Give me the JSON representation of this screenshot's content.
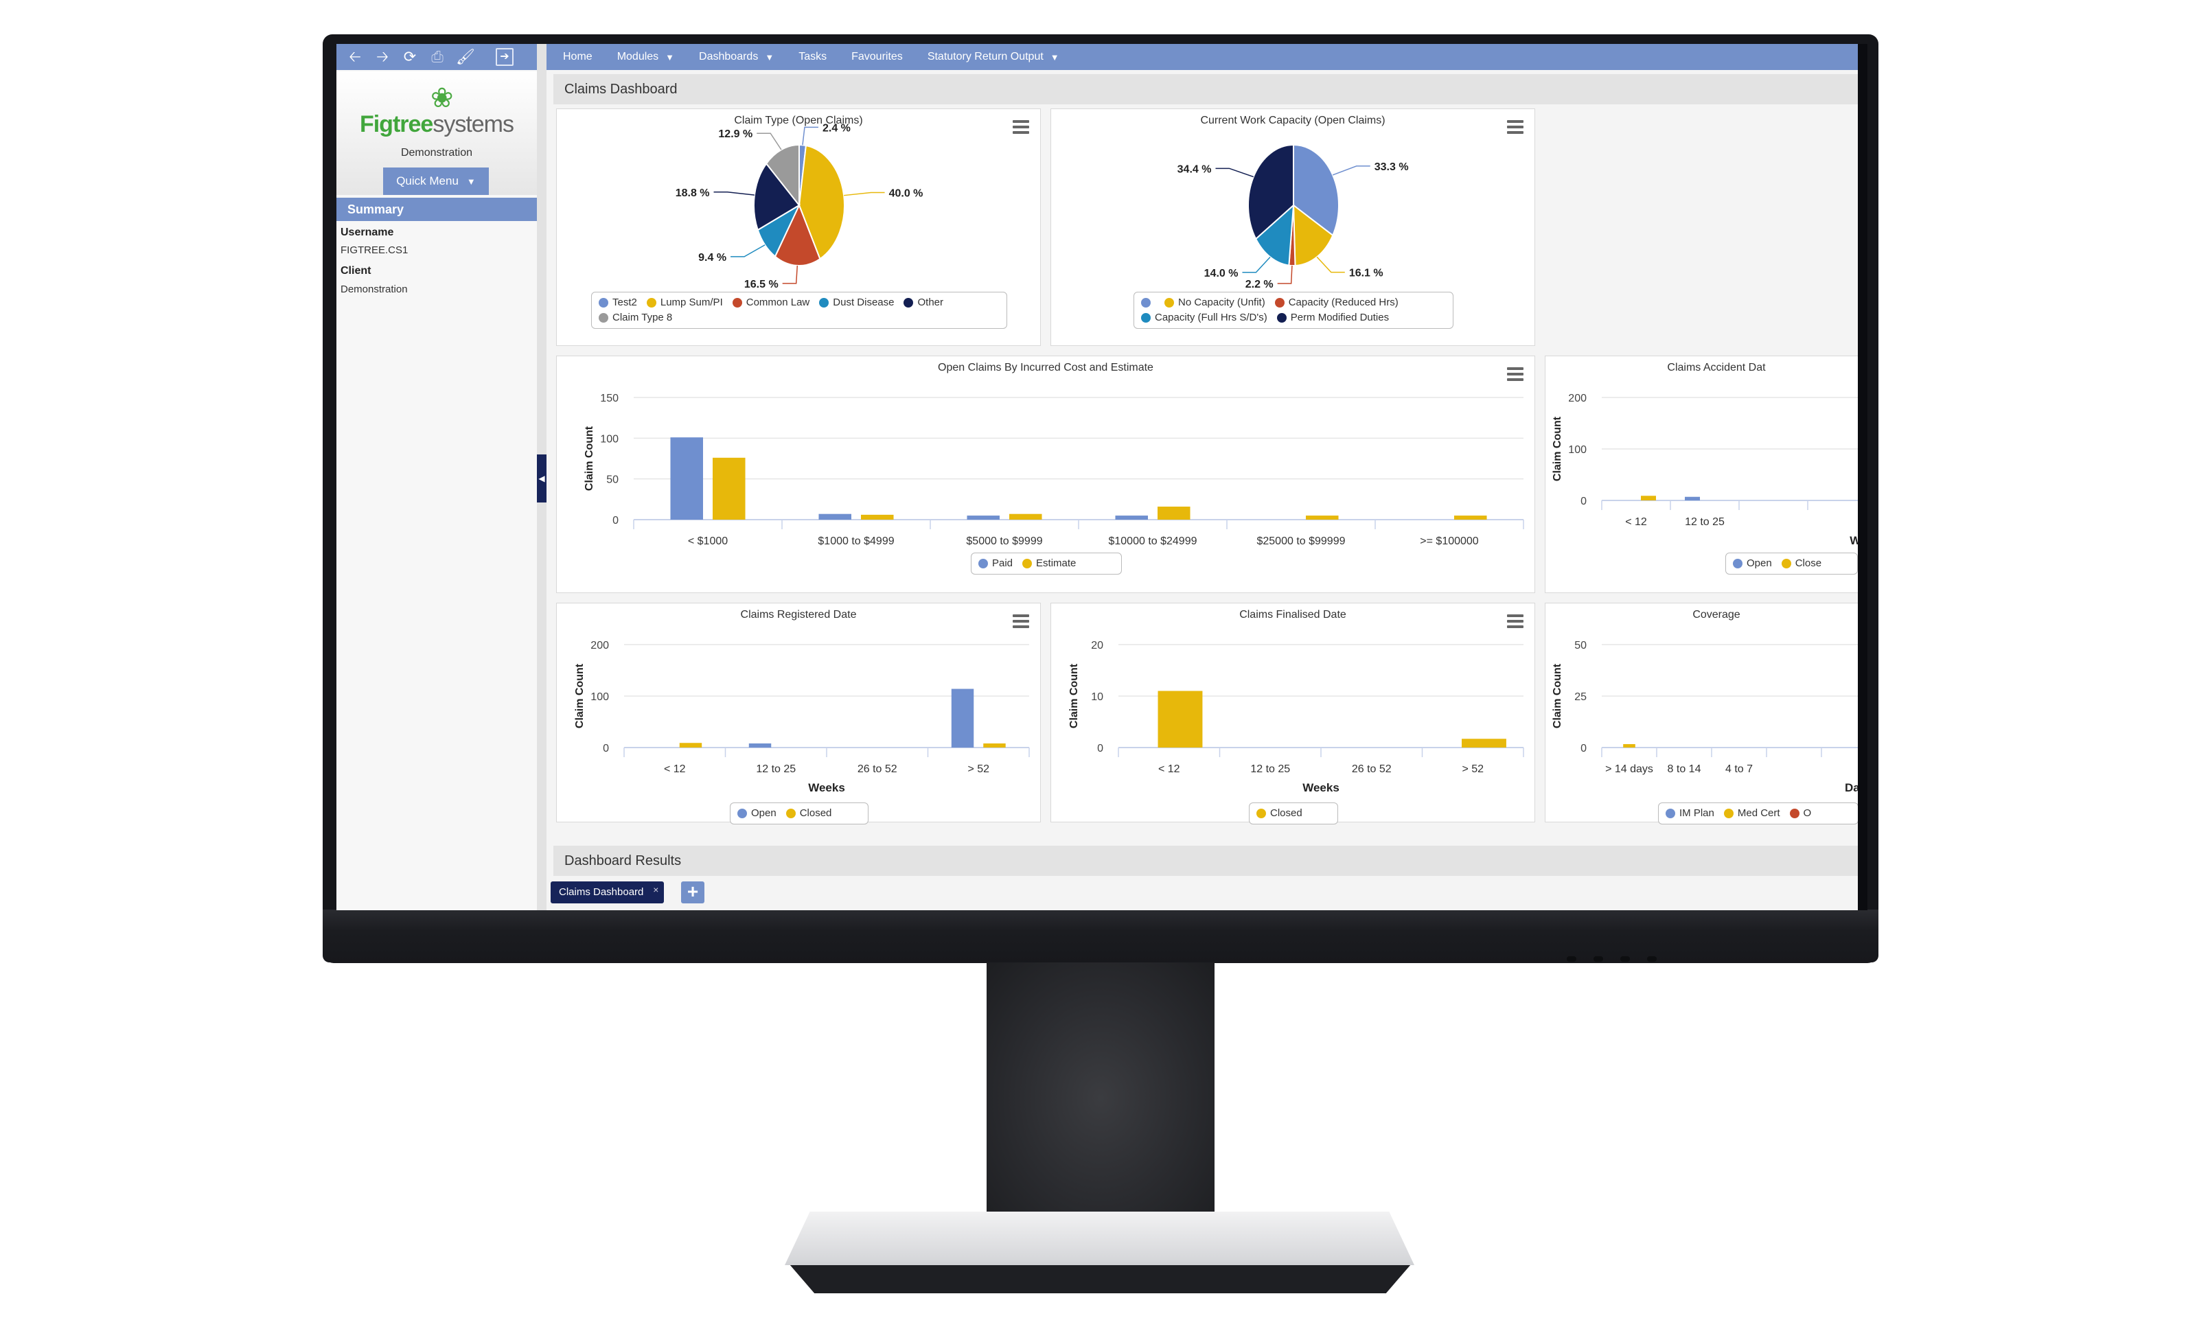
{
  "toolbar": {
    "icons": [
      "back-arrow-icon",
      "forward-arrow-icon",
      "refresh-icon",
      "print-icon",
      "brush-icon",
      "logout-icon"
    ]
  },
  "brand": {
    "name_green": "Figtree",
    "name_grey": "systems",
    "client": "Demonstration"
  },
  "quick_menu": {
    "label": "Quick Menu"
  },
  "summary": {
    "title": "Summary",
    "username_label": "Username",
    "username": "FIGTREE.CS1",
    "client_label": "Client",
    "client": "Demonstration"
  },
  "nav": {
    "items": [
      {
        "label": "Home",
        "dropdown": false
      },
      {
        "label": "Modules",
        "dropdown": true
      },
      {
        "label": "Dashboards",
        "dropdown": true
      },
      {
        "label": "Tasks",
        "dropdown": false
      },
      {
        "label": "Favourites",
        "dropdown": false
      },
      {
        "label": "Statutory Return Output",
        "dropdown": true
      }
    ]
  },
  "dashboard": {
    "title": "Claims Dashboard"
  },
  "results": {
    "title": "Dashboard Results",
    "tab_label": "Claims Dashboard",
    "close": "×",
    "add": "+"
  },
  "colors": {
    "blue": "#6f8fcf",
    "yellow": "#e7b80b",
    "red": "#c4492b",
    "teal": "#1f8bbf",
    "navy": "#131f52",
    "grey": "#9a9a9a",
    "accent": "#7390c9"
  },
  "chart_data": [
    {
      "id": "claim-type",
      "type": "pie",
      "title": "Claim Type (Open Claims)",
      "slices": [
        {
          "label": "Test2",
          "value": 2.4,
          "color": "#6f8fcf"
        },
        {
          "label": "Lump Sum/PI",
          "value": 40.0,
          "color": "#e7b80b"
        },
        {
          "label": "Common Law",
          "value": 16.5,
          "color": "#c4492b"
        },
        {
          "label": "Dust Disease",
          "value": 9.4,
          "color": "#1f8bbf"
        },
        {
          "label": "Other",
          "value": 18.8,
          "color": "#131f52"
        },
        {
          "label": "Claim Type 8",
          "value": 12.9,
          "color": "#9a9a9a"
        }
      ],
      "data_labels": [
        "2.4 %",
        "40.0 %",
        "16.5 %",
        "9.4 %",
        "18.8 %",
        "12.9 %"
      ],
      "legend": "bottom"
    },
    {
      "id": "work-capacity",
      "type": "pie",
      "title": "Current Work Capacity (Open Claims)",
      "slices": [
        {
          "label": "",
          "value": 33.3,
          "color": "#6f8fcf"
        },
        {
          "label": "No Capacity (Unfit)",
          "value": 16.1,
          "color": "#e7b80b"
        },
        {
          "label": "Capacity (Reduced Hrs)",
          "value": 2.2,
          "color": "#c4492b"
        },
        {
          "label": "Capacity (Full Hrs S/D's)",
          "value": 14.0,
          "color": "#1f8bbf"
        },
        {
          "label": "Perm Modified Duties",
          "value": 34.4,
          "color": "#131f52"
        }
      ],
      "data_labels": [
        "33.3 %",
        "16.1 %",
        "2.2 %",
        "14.0 %",
        "34.4 %"
      ],
      "legend": "bottom"
    },
    {
      "id": "incurred-cost",
      "type": "bar",
      "title": "Open Claims By Incurred Cost and Estimate",
      "xlabel": "",
      "ylabel": "Claim Count",
      "ylim": [
        0,
        150
      ],
      "yticks": [
        0,
        50,
        100,
        150
      ],
      "categories": [
        "< $1000",
        "$1000 to $4999",
        "$5000 to $9999",
        "$10000 to $24999",
        "$25000 to $99999",
        ">= $100000"
      ],
      "series": [
        {
          "name": "Paid",
          "color": "#6f8fcf",
          "values": [
            101,
            7,
            5,
            5,
            0,
            0
          ]
        },
        {
          "name": "Estimate",
          "color": "#e7b80b",
          "values": [
            76,
            6,
            7,
            16,
            5,
            5
          ]
        }
      ],
      "legend": "bottom"
    },
    {
      "id": "accident-date",
      "type": "bar",
      "title": "Claims Accident Dat",
      "xlabel": "Weeks",
      "ylabel": "Claim Count",
      "ylim": [
        0,
        200
      ],
      "yticks": [
        0,
        100,
        200
      ],
      "categories": [
        "< 12",
        "12 to 25"
      ],
      "series": [
        {
          "name": "Open",
          "color": "#6f8fcf",
          "values": [
            0,
            7
          ]
        },
        {
          "name": "Close",
          "color": "#e7b80b",
          "values": [
            9,
            0
          ]
        }
      ],
      "legend": "bottom"
    },
    {
      "id": "registered-date",
      "type": "bar",
      "title": "Claims Registered Date",
      "xlabel": "Weeks",
      "ylabel": "Claim Count",
      "ylim": [
        0,
        200
      ],
      "yticks": [
        0,
        100,
        200
      ],
      "categories": [
        "< 12",
        "12 to 25",
        "26 to 52",
        "> 52"
      ],
      "series": [
        {
          "name": "Open",
          "color": "#6f8fcf",
          "values": [
            0,
            8,
            0,
            114
          ]
        },
        {
          "name": "Closed",
          "color": "#e7b80b",
          "values": [
            9,
            0,
            0,
            8
          ]
        }
      ],
      "legend": "bottom"
    },
    {
      "id": "finalised-date",
      "type": "bar",
      "title": "Claims Finalised Date",
      "xlabel": "Weeks",
      "ylabel": "Claim Count",
      "ylim": [
        0,
        20
      ],
      "yticks": [
        0,
        10,
        20
      ],
      "categories": [
        "< 12",
        "12 to 25",
        "26 to 52",
        "> 52"
      ],
      "series": [
        {
          "name": "Closed",
          "color": "#e7b80b",
          "values": [
            11,
            0,
            0,
            1.7
          ]
        }
      ],
      "legend": "bottom"
    },
    {
      "id": "coverage",
      "type": "bar",
      "title": "Coverage",
      "xlabel": "Days Du",
      "ylabel": "Claim Count",
      "ylim": [
        0,
        50
      ],
      "yticks": [
        0,
        25,
        50
      ],
      "categories": [
        "> 14 days",
        "8 to 14",
        "4 to 7"
      ],
      "series": [
        {
          "name": "IM Plan",
          "color": "#6f8fcf",
          "values": [
            0,
            0,
            0
          ]
        },
        {
          "name": "Med Cert",
          "color": "#e7b80b",
          "values": [
            1,
            0,
            0
          ]
        },
        {
          "name": "O",
          "color": "#c4492b",
          "values": [
            0,
            0,
            0
          ]
        }
      ],
      "legend": "bottom"
    }
  ]
}
